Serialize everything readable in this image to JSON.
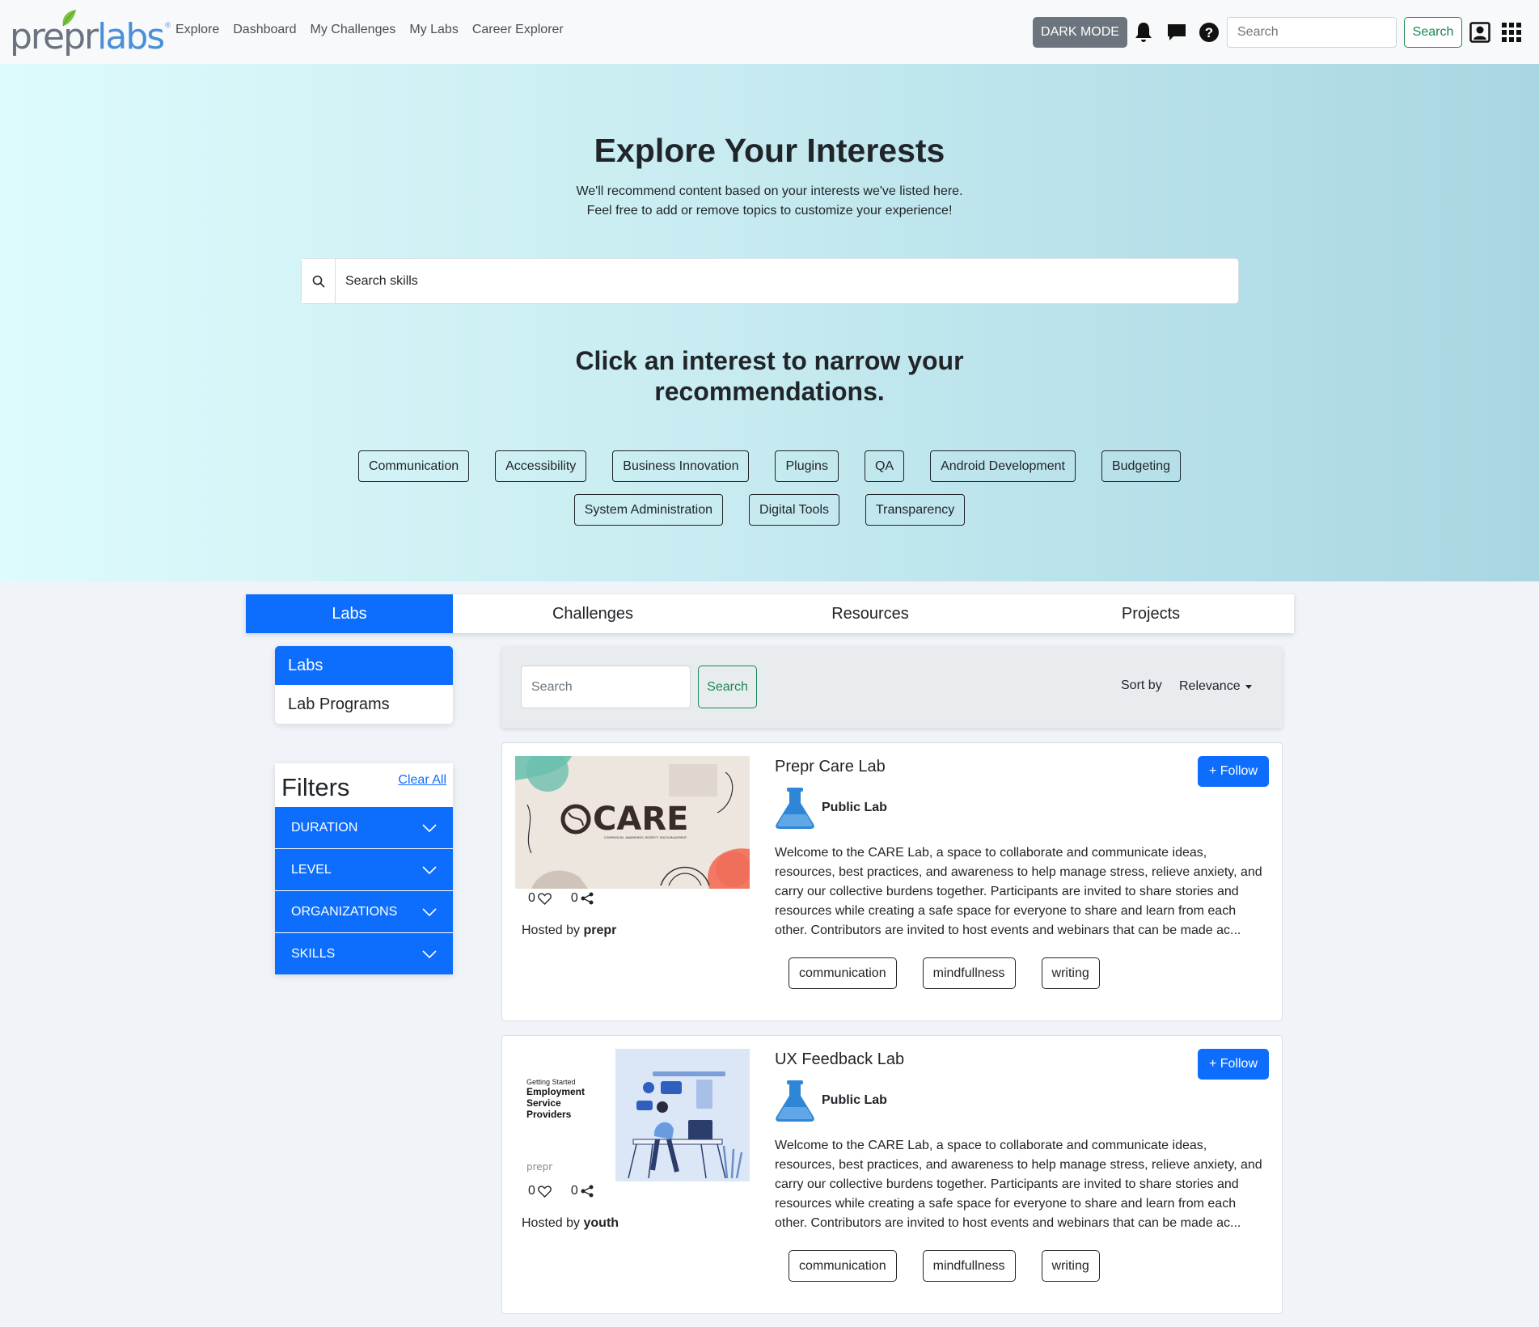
{
  "header": {
    "logo_text_prep": "prepr",
    "logo_text_labs": "labs",
    "nav": [
      "Explore",
      "Dashboard",
      "My Challenges",
      "My Labs",
      "Career Explorer"
    ],
    "dark_mode_label": "DARK MODE",
    "search_placeholder": "Search",
    "search_button": "Search"
  },
  "hero": {
    "title": "Explore Your Interests",
    "subtitle_line1": "We'll recommend content based on your interests we've listed here.",
    "subtitle_line2": "Feel free to add or remove topics to customize your experience!",
    "skill_search_placeholder": "Search skills",
    "narrow_line1": "Click an interest to narrow your",
    "narrow_line2": "recommendations.",
    "interests_row1": [
      "Communication",
      "Accessibility",
      "Business Innovation",
      "Plugins",
      "QA",
      "Android Development",
      "Budgeting"
    ],
    "interests_row2": [
      "System Administration",
      "Digital Tools",
      "Transparency"
    ]
  },
  "tabs": {
    "items": [
      "Labs",
      "Challenges",
      "Resources",
      "Projects"
    ],
    "active": "Labs"
  },
  "sub_tabs": {
    "items": [
      "Labs",
      "Lab Programs"
    ],
    "active": "Labs"
  },
  "filters": {
    "title": "Filters",
    "clear_all": "Clear All",
    "items": [
      "DURATION",
      "LEVEL",
      "ORGANIZATIONS",
      "SKILLS"
    ]
  },
  "list_controls": {
    "search_placeholder": "Search",
    "search_button": "Search",
    "sort_label": "Sort by",
    "sort_value": "Relevance"
  },
  "labs": [
    {
      "title": "Prepr Care Lab",
      "follow_label": "+ Follow",
      "type": "Public Lab",
      "likes": "0",
      "shares": "0",
      "hosted_prefix": "Hosted by",
      "host": "prepr",
      "image_text": "CARE",
      "image_tagline": "COMPASSION. AWARENESS. RESPECT. ENCOURAGEMENT.",
      "description": "Welcome to the CARE Lab, a space to collaborate and communicate ideas, resources, best practices, and awareness to help manage stress, relieve anxiety, and carry our collective burdens together. Participants are invited to share stories and resources while creating a safe space for everyone to share and learn from each other. Contributors are invited to host events and webinars that can be made ac...",
      "tags": [
        "communication",
        "mindfullness",
        "writing"
      ]
    },
    {
      "title": "UX Feedback Lab",
      "follow_label": "+ Follow",
      "type": "Public Lab",
      "likes": "0",
      "shares": "0",
      "hosted_prefix": "Hosted by",
      "host": "youth",
      "image_text_small": "Getting Started",
      "image_text_big": "Employment Service Providers",
      "image_logo": "prepr",
      "description": "Welcome to the CARE Lab, a space to collaborate and communicate ideas, resources, best practices, and awareness to help manage stress, relieve anxiety, and carry our collective burdens together. Participants are invited to share stories and resources while creating a safe space for everyone to share and learn from each other. Contributors are invited to host events and webinars that can be made ac...",
      "tags": [
        "communication",
        "mindfullness",
        "writing"
      ]
    }
  ],
  "colors": {
    "primary": "#0d6efd",
    "success": "#198754",
    "dark_mode_bg": "#6c757d",
    "flask": "#2f86d6"
  }
}
